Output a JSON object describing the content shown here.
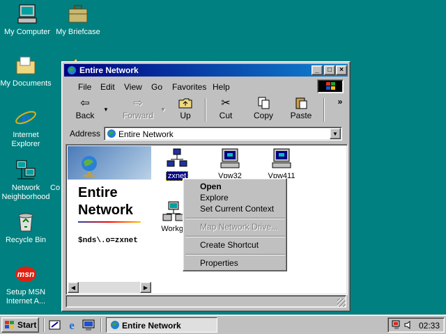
{
  "desktop": {
    "icons": [
      {
        "label": "My Computer",
        "icon": "my-computer-icon"
      },
      {
        "label": "My Briefcase",
        "icon": "briefcase-icon"
      },
      {
        "label": "My Documents",
        "icon": "folder-icon"
      },
      {
        "label": "Internet Explorer",
        "icon": "internet-explorer-icon"
      },
      {
        "label": "Network Neighborhood",
        "icon": "network-neighborhood-icon"
      },
      {
        "label": "Recycle Bin",
        "icon": "recycle-bin-icon"
      },
      {
        "label": "Setup MSN Internet A...",
        "icon": "msn-icon"
      }
    ],
    "partial_label": "Co"
  },
  "window": {
    "title": "Entire Network",
    "menu": [
      "File",
      "Edit",
      "View",
      "Go",
      "Favorites",
      "Help"
    ],
    "toolbar": {
      "back": "Back",
      "forward": "Forward",
      "up": "Up",
      "cut": "Cut",
      "copy": "Copy",
      "paste": "Paste"
    },
    "address_label": "Address",
    "address_value": "Entire Network",
    "panel_title": "Entire Network",
    "panel_path": "$nds\\.o=zxnet",
    "items": [
      {
        "label": "zxnet",
        "icon": "network-tree-icon",
        "selected": true
      },
      {
        "label": "Vpw32",
        "icon": "computer-icon"
      },
      {
        "label": "Vpw411",
        "icon": "computer-icon"
      },
      {
        "label": "Workgr",
        "icon": "workgroup-icon"
      }
    ]
  },
  "context_menu": {
    "items": [
      {
        "label": "Open",
        "bold": true,
        "enabled": true
      },
      {
        "label": "Explore",
        "enabled": true
      },
      {
        "label": "Set Current Context",
        "enabled": true
      },
      {
        "label": "Map Network Drive...",
        "enabled": false
      },
      {
        "label": "Create Shortcut",
        "enabled": true
      },
      {
        "label": "Properties",
        "enabled": true
      }
    ]
  },
  "taskbar": {
    "start_label": "Start",
    "active_task": "Entire Network",
    "clock": "02:33"
  }
}
